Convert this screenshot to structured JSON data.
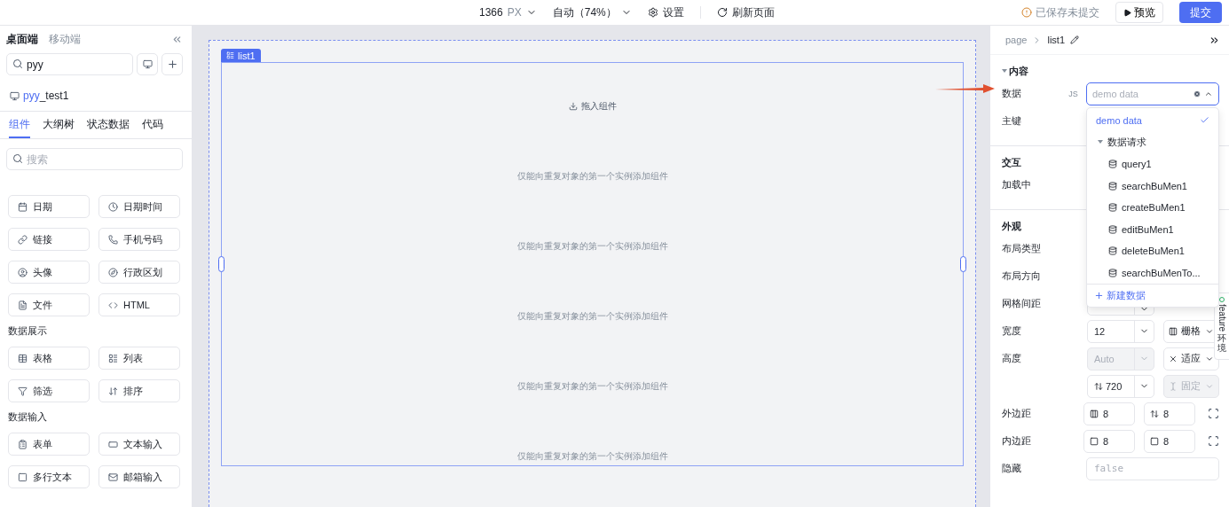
{
  "topbar": {
    "width_value": "1366",
    "width_unit": "PX",
    "zoom": "自动（74%）",
    "settings": "设置",
    "refresh": "刷新页面",
    "save_status": "已保存未提交",
    "preview": "预览",
    "submit": "提交"
  },
  "left_panel": {
    "device_tabs": [
      {
        "label": "桌面端",
        "selected": true
      },
      {
        "label": "移动端",
        "selected": false
      }
    ],
    "page_search": {
      "value": "pyy"
    },
    "pages": [
      {
        "match": "pyy",
        "rest": "_test1"
      }
    ],
    "tabs": [
      {
        "label": "组件",
        "selected": true
      },
      {
        "label": "大纲树",
        "selected": false
      },
      {
        "label": "状态数据",
        "selected": false
      },
      {
        "label": "代码",
        "selected": false
      }
    ],
    "component_search": {
      "placeholder": "搜索"
    },
    "sections": [
      {
        "items": [
          "日期",
          "日期时间",
          "链接",
          "手机号码",
          "头像",
          "行政区划",
          "文件",
          "HTML"
        ]
      },
      {
        "title": "数据展示",
        "items": [
          "表格",
          "列表",
          "筛选",
          "排序"
        ]
      },
      {
        "title": "数据输入",
        "items": [
          "表单",
          "文本输入",
          "多行文本",
          "邮箱输入"
        ]
      }
    ]
  },
  "canvas": {
    "component": "list1",
    "drop_hint": "拖入组件",
    "repeat_hints": [
      "仅能向重复对象的第一个实例添加组件",
      "仅能向重复对象的第一个实例添加组件",
      "仅能向重复对象的第一个实例添加组件",
      "仅能向重复对象的第一个实例添加组件",
      "仅能向重复对象的第一个实例添加组件"
    ]
  },
  "right_panel": {
    "breadcrumb": [
      "page",
      "list1"
    ],
    "groups": [
      {
        "title": "内容",
        "expanded": true,
        "rows": [
          {
            "label": "数据",
            "prefix": "JS",
            "controls": [
              {
                "kind": "combo",
                "placeholder": "demo data",
                "open": true,
                "options": [
                  {
                    "kind": "option",
                    "label": "demo data",
                    "selected": true
                  },
                  {
                    "kind": "group",
                    "label": "数据请求",
                    "expanded": true,
                    "children": [
                      {
                        "label": "query1",
                        "selected": false
                      },
                      {
                        "label": "searchBuMen1",
                        "selected": false
                      },
                      {
                        "label": "createBuMen1",
                        "selected": false
                      },
                      {
                        "label": "editBuMen1",
                        "selected": false
                      },
                      {
                        "label": "deleteBuMen1",
                        "selected": false
                      },
                      {
                        "label": "searchBuMenTo...",
                        "selected": false
                      }
                    ]
                  }
                ],
                "footer": "新建数据"
              }
            ]
          },
          {
            "label": "主键"
          }
        ]
      },
      {
        "title": "交互",
        "rows": [
          {
            "label": "加载中"
          }
        ]
      },
      {
        "title": "外观",
        "rows": [
          {
            "label": "布局类型"
          },
          {
            "label": "布局方向"
          },
          {
            "label": "网格间距",
            "controls": [
              {
                "kind": "select"
              }
            ]
          },
          {
            "label": "宽度",
            "controls": [
              {
                "kind": "select",
                "value": "12",
                "disabled": false
              },
              {
                "kind": "mode_select",
                "value": "栅格",
                "disabled": false
              }
            ]
          },
          {
            "label": "高度",
            "controls": [
              {
                "kind": "select",
                "value": "Auto",
                "disabled": true
              },
              {
                "kind": "mode_select",
                "value": "适应",
                "disabled": false
              }
            ]
          },
          {
            "controls": [
              {
                "kind": "select",
                "value": "720",
                "disabled": false
              },
              {
                "kind": "mode_select",
                "value": "固定",
                "disabled": true
              }
            ]
          },
          {
            "label": "外边距",
            "controls": [
              {
                "kind": "input",
                "value": "8"
              },
              {
                "kind": "input",
                "value": "8"
              },
              {
                "kind": "reset_button"
              }
            ]
          },
          {
            "label": "内边距",
            "controls": [
              {
                "kind": "input",
                "value": "8"
              },
              {
                "kind": "input",
                "value": "8"
              },
              {
                "kind": "reset_button"
              }
            ]
          },
          {
            "label": "隐藏",
            "controls": [
              {
                "kind": "text_input",
                "placeholder": "false"
              }
            ]
          }
        ]
      }
    ]
  },
  "feature_tab": {
    "label": "feature",
    "env": "环境"
  }
}
